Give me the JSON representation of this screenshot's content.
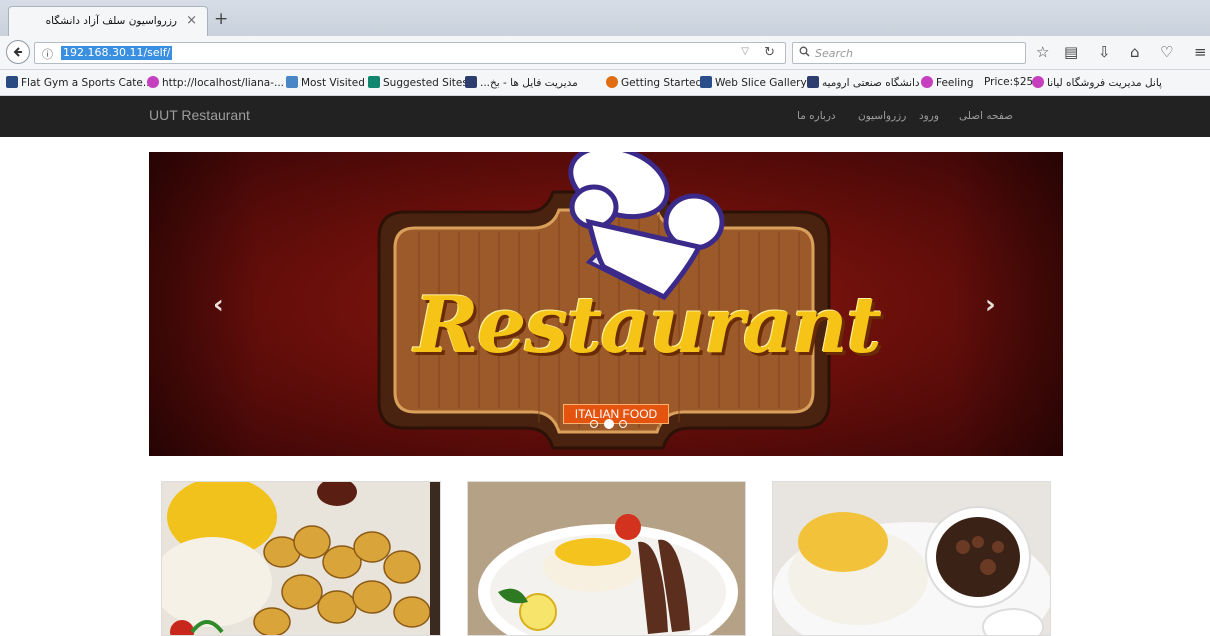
{
  "browser": {
    "tab": {
      "title": "رزرواسیون سلف آزاد دانشگاه",
      "close": "×"
    },
    "new_tab": "+",
    "url": "192.168.30.11/self/",
    "search_placeholder": "Search",
    "toolbar_icons": [
      "star-icon",
      "reading-list-icon",
      "download-icon",
      "home-icon",
      "pocket-icon",
      "menu-icon"
    ]
  },
  "bookmarks": [
    "Flat Gym a Sports Cate...",
    "http://localhost/liana-...",
    "Most Visited",
    "Suggested Sites",
    "...مدیریت فایل ها - بخ",
    "Getting Started",
    "Web Slice Gallery",
    "دانشگاه صنعتی ارومیه",
    "Feeling",
    "Price:$25",
    "پانل مدیریت فروشگاه لیانا"
  ],
  "site": {
    "brand": "UUT Restaurant",
    "menu": [
      "صفحه اصلی",
      "ورود",
      "رزرواسیون",
      "درباره ما"
    ]
  },
  "carousel": {
    "headline": "Restaurant",
    "tagline": "ITALIAN FOOD",
    "prev": "‹",
    "next": "›",
    "slides_count": 3,
    "active_index": 1
  },
  "colors": {
    "navbar": "#222222",
    "menu_text": "#9d9d9d",
    "carousel_bg": "#7a1410",
    "headline_yellow": "#f6c416",
    "tagline_bg": "#e5540f"
  }
}
